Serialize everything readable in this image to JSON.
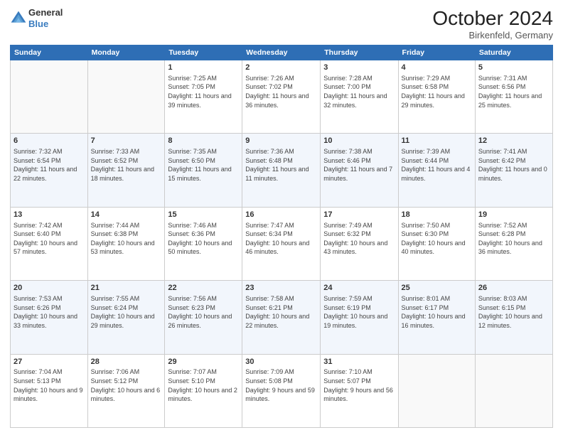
{
  "header": {
    "logo": {
      "general": "General",
      "blue": "Blue"
    },
    "title": "October 2024",
    "location": "Birkenfeld, Germany"
  },
  "days_of_week": [
    "Sunday",
    "Monday",
    "Tuesday",
    "Wednesday",
    "Thursday",
    "Friday",
    "Saturday"
  ],
  "weeks": [
    [
      {
        "num": "",
        "detail": ""
      },
      {
        "num": "",
        "detail": ""
      },
      {
        "num": "1",
        "detail": "Sunrise: 7:25 AM\nSunset: 7:05 PM\nDaylight: 11 hours and 39 minutes."
      },
      {
        "num": "2",
        "detail": "Sunrise: 7:26 AM\nSunset: 7:02 PM\nDaylight: 11 hours and 36 minutes."
      },
      {
        "num": "3",
        "detail": "Sunrise: 7:28 AM\nSunset: 7:00 PM\nDaylight: 11 hours and 32 minutes."
      },
      {
        "num": "4",
        "detail": "Sunrise: 7:29 AM\nSunset: 6:58 PM\nDaylight: 11 hours and 29 minutes."
      },
      {
        "num": "5",
        "detail": "Sunrise: 7:31 AM\nSunset: 6:56 PM\nDaylight: 11 hours and 25 minutes."
      }
    ],
    [
      {
        "num": "6",
        "detail": "Sunrise: 7:32 AM\nSunset: 6:54 PM\nDaylight: 11 hours and 22 minutes."
      },
      {
        "num": "7",
        "detail": "Sunrise: 7:33 AM\nSunset: 6:52 PM\nDaylight: 11 hours and 18 minutes."
      },
      {
        "num": "8",
        "detail": "Sunrise: 7:35 AM\nSunset: 6:50 PM\nDaylight: 11 hours and 15 minutes."
      },
      {
        "num": "9",
        "detail": "Sunrise: 7:36 AM\nSunset: 6:48 PM\nDaylight: 11 hours and 11 minutes."
      },
      {
        "num": "10",
        "detail": "Sunrise: 7:38 AM\nSunset: 6:46 PM\nDaylight: 11 hours and 7 minutes."
      },
      {
        "num": "11",
        "detail": "Sunrise: 7:39 AM\nSunset: 6:44 PM\nDaylight: 11 hours and 4 minutes."
      },
      {
        "num": "12",
        "detail": "Sunrise: 7:41 AM\nSunset: 6:42 PM\nDaylight: 11 hours and 0 minutes."
      }
    ],
    [
      {
        "num": "13",
        "detail": "Sunrise: 7:42 AM\nSunset: 6:40 PM\nDaylight: 10 hours and 57 minutes."
      },
      {
        "num": "14",
        "detail": "Sunrise: 7:44 AM\nSunset: 6:38 PM\nDaylight: 10 hours and 53 minutes."
      },
      {
        "num": "15",
        "detail": "Sunrise: 7:46 AM\nSunset: 6:36 PM\nDaylight: 10 hours and 50 minutes."
      },
      {
        "num": "16",
        "detail": "Sunrise: 7:47 AM\nSunset: 6:34 PM\nDaylight: 10 hours and 46 minutes."
      },
      {
        "num": "17",
        "detail": "Sunrise: 7:49 AM\nSunset: 6:32 PM\nDaylight: 10 hours and 43 minutes."
      },
      {
        "num": "18",
        "detail": "Sunrise: 7:50 AM\nSunset: 6:30 PM\nDaylight: 10 hours and 40 minutes."
      },
      {
        "num": "19",
        "detail": "Sunrise: 7:52 AM\nSunset: 6:28 PM\nDaylight: 10 hours and 36 minutes."
      }
    ],
    [
      {
        "num": "20",
        "detail": "Sunrise: 7:53 AM\nSunset: 6:26 PM\nDaylight: 10 hours and 33 minutes."
      },
      {
        "num": "21",
        "detail": "Sunrise: 7:55 AM\nSunset: 6:24 PM\nDaylight: 10 hours and 29 minutes."
      },
      {
        "num": "22",
        "detail": "Sunrise: 7:56 AM\nSunset: 6:23 PM\nDaylight: 10 hours and 26 minutes."
      },
      {
        "num": "23",
        "detail": "Sunrise: 7:58 AM\nSunset: 6:21 PM\nDaylight: 10 hours and 22 minutes."
      },
      {
        "num": "24",
        "detail": "Sunrise: 7:59 AM\nSunset: 6:19 PM\nDaylight: 10 hours and 19 minutes."
      },
      {
        "num": "25",
        "detail": "Sunrise: 8:01 AM\nSunset: 6:17 PM\nDaylight: 10 hours and 16 minutes."
      },
      {
        "num": "26",
        "detail": "Sunrise: 8:03 AM\nSunset: 6:15 PM\nDaylight: 10 hours and 12 minutes."
      }
    ],
    [
      {
        "num": "27",
        "detail": "Sunrise: 7:04 AM\nSunset: 5:13 PM\nDaylight: 10 hours and 9 minutes."
      },
      {
        "num": "28",
        "detail": "Sunrise: 7:06 AM\nSunset: 5:12 PM\nDaylight: 10 hours and 6 minutes."
      },
      {
        "num": "29",
        "detail": "Sunrise: 7:07 AM\nSunset: 5:10 PM\nDaylight: 10 hours and 2 minutes."
      },
      {
        "num": "30",
        "detail": "Sunrise: 7:09 AM\nSunset: 5:08 PM\nDaylight: 9 hours and 59 minutes."
      },
      {
        "num": "31",
        "detail": "Sunrise: 7:10 AM\nSunset: 5:07 PM\nDaylight: 9 hours and 56 minutes."
      },
      {
        "num": "",
        "detail": ""
      },
      {
        "num": "",
        "detail": ""
      }
    ]
  ]
}
